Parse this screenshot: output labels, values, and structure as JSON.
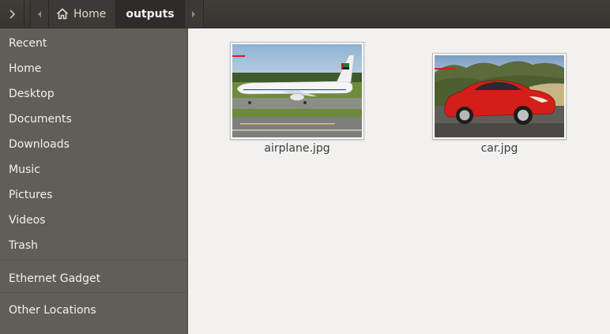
{
  "header": {
    "sidebar_toggle_icon": "chevron-right-icon",
    "back_icon": "chevron-left-icon",
    "forward_icon": "chevron-right-icon",
    "path": [
      {
        "label": "Home",
        "icon": "home-icon"
      },
      {
        "label": "outputs"
      }
    ]
  },
  "sidebar": {
    "items": [
      {
        "label": "Recent"
      },
      {
        "label": "Home"
      },
      {
        "label": "Desktop"
      },
      {
        "label": "Documents"
      },
      {
        "label": "Downloads"
      },
      {
        "label": "Music"
      },
      {
        "label": "Pictures"
      },
      {
        "label": "Videos"
      },
      {
        "label": "Trash"
      },
      {
        "label": "Ethernet Gadget"
      },
      {
        "label": "Other Locations"
      }
    ]
  },
  "files": [
    {
      "name": "airplane.jpg",
      "thumbnail": "airplane-photo"
    },
    {
      "name": "car.jpg",
      "thumbnail": "car-photo"
    }
  ],
  "colors": {
    "header_bg": "#3b3a36",
    "sidebar_bg": "#605e56",
    "content_bg": "#f2f1f0",
    "car_red": "#d41e1a"
  }
}
